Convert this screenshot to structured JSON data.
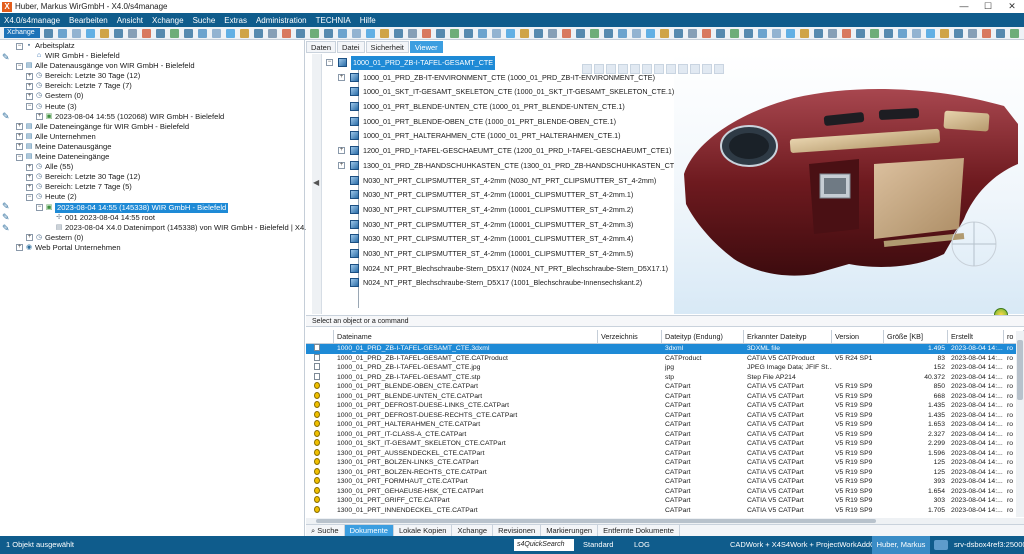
{
  "window": {
    "title": "Huber, Markus WirGmbH - X4.0/s4manage",
    "app_icon": "X",
    "minimize": "—",
    "maximize": "☐",
    "close": "✕"
  },
  "menu": [
    "X4.0/s4manage",
    "Bearbeiten",
    "Ansicht",
    "Xchange",
    "Suche",
    "Extras",
    "Administration",
    "TECHNIA",
    "Hilfe"
  ],
  "toolbar": {
    "select_value": "Xchange",
    "icon_count": 70
  },
  "tree": [
    {
      "label": "Arbeitsplatz",
      "level": 0,
      "exp": "-",
      "icon": "▪",
      "color": "#5a7a9a"
    },
    {
      "label": "WIR GmbH - Bielefeld",
      "level": 1,
      "exp": "",
      "icon": "⌂",
      "color": "#1e5fa8"
    },
    {
      "label": "Alle Datenausgänge von WIR GmbH - Bielefeld",
      "level": 0,
      "exp": "-",
      "icon": "▤",
      "color": "#2f6f9e"
    },
    {
      "label": "Bereich: Letzte 30 Tage (12)",
      "level": 1,
      "exp": "+",
      "icon": "◷",
      "color": "#4a6a8a"
    },
    {
      "label": "Bereich: Letzte 7 Tage (7)",
      "level": 1,
      "exp": "+",
      "icon": "◷",
      "color": "#4a6a8a"
    },
    {
      "label": "Gestern (0)",
      "level": 1,
      "exp": "+",
      "icon": "◷",
      "color": "#4a6a8a"
    },
    {
      "label": "Heute (3)",
      "level": 1,
      "exp": "-",
      "icon": "◷",
      "color": "#4a6a8a"
    },
    {
      "label": "2023-08-04 14:55 (102068) WIR GmbH - Bielefeld",
      "level": 2,
      "exp": "+",
      "icon": "▣",
      "color": "#3f8f3f"
    },
    {
      "label": "Alle Dateneingänge für WIR GmbH - Bielefeld",
      "level": 0,
      "exp": "+",
      "icon": "▤",
      "color": "#2f6f9e"
    },
    {
      "label": "Alle Unternehmen",
      "level": 0,
      "exp": "+",
      "icon": "▤",
      "color": "#2f6f9e"
    },
    {
      "label": "Meine Datenausgänge",
      "level": 0,
      "exp": "+",
      "icon": "▤",
      "color": "#2f6f9e"
    },
    {
      "label": "Meine Dateneingänge",
      "level": 0,
      "exp": "-",
      "icon": "▤",
      "color": "#2f6f9e"
    },
    {
      "label": "Alle (55)",
      "level": 1,
      "exp": "+",
      "icon": "◷",
      "color": "#4a6a8a"
    },
    {
      "label": "Bereich: Letzte 30 Tage (12)",
      "level": 1,
      "exp": "+",
      "icon": "◷",
      "color": "#4a6a8a"
    },
    {
      "label": "Bereich: Letzte 7 Tage (5)",
      "level": 1,
      "exp": "+",
      "icon": "◷",
      "color": "#4a6a8a"
    },
    {
      "label": "Heute (2)",
      "level": 1,
      "exp": "-",
      "icon": "◷",
      "color": "#4a6a8a"
    },
    {
      "label": "2023-08-04 14:55 (145338) WIR GmbH - Bielefeld",
      "level": 2,
      "exp": "-",
      "icon": "▣",
      "color": "#3f8f3f",
      "selected": true
    },
    {
      "label": "001 2023-08-04 14:55 root",
      "level": 3,
      "exp": "",
      "icon": "✢",
      "color": "#7a8a9a"
    },
    {
      "label": "2023-08-04 X4.0 Datenimport (145338) von WIR GmbH - Bielefeld | X4...",
      "level": 3,
      "exp": "",
      "icon": "▤",
      "color": "#7a8a9a"
    },
    {
      "label": "Gestern (0)",
      "level": 1,
      "exp": "+",
      "icon": "◷",
      "color": "#4a6a8a"
    },
    {
      "label": "Web Portal Unternehmen",
      "level": 0,
      "exp": "+",
      "icon": "◉",
      "color": "#2f6f9e"
    }
  ],
  "tabs": [
    {
      "label": "Daten"
    },
    {
      "label": "Datei"
    },
    {
      "label": "Sicherheit"
    },
    {
      "label": "Viewer",
      "active": true
    }
  ],
  "ptree": [
    "1000_01_PRD_ZB-I-TAFEL-GESAMT_CTE",
    "1000_01_PRD_ZB-IT-ENVIRONMENT_CTE (1000_01_PRD_ZB-IT-ENVIRONMENT_CTE)",
    "1000_01_SKT_IT-GESAMT_SKELETON_CTE (1000_01_SKT_IT-GESAMT_SKELETON_CTE.1)",
    "1000_01_PRT_BLENDE-UNTEN_CTE (1000_01_PRT_BLENDE-UNTEN_CTE.1)",
    "1000_01_PRT_BLENDE-OBEN_CTE (1000_01_PRT_BLENDE-OBEN_CTE.1)",
    "1000_01_PRT_HALTERAHMEN_CTE (1000_01_PRT_HALTERAHMEN_CTE.1)",
    "1200_01_PRD_I-TAFEL-GESCHAEUMT_CTE (1200_01_PRD_I-TAFEL-GESCHAEUMT_CTE1)",
    "1300_01_PRD_ZB-HANDSCHUHKASTEN_CTE (1300_01_PRD_ZB-HANDSCHUHKASTEN_CTI",
    "N030_NT_PRT_CLIPSMUTTER_ST_4-2mm (N030_NT_PRT_CLIPSMUTTER_ST_4-2mm)",
    "N030_NT_PRT_CLIPSMUTTER_ST_4-2mm (10001_CLIPSMUTTER_ST_4-2mm.1)",
    "N030_NT_PRT_CLIPSMUTTER_ST_4-2mm (10001_CLIPSMUTTER_ST_4-2mm.2)",
    "N030_NT_PRT_CLIPSMUTTER_ST_4-2mm (10001_CLIPSMUTTER_ST_4-2mm.3)",
    "N030_NT_PRT_CLIPSMUTTER_ST_4-2mm (10001_CLIPSMUTTER_ST_4-2mm.4)",
    "N030_NT_PRT_CLIPSMUTTER_ST_4-2mm (10001_CLIPSMUTTER_ST_4-2mm.5)",
    "N024_NT_PRT_Blechschraube-Stern_D5X17 (N024_NT_PRT_Blechschraube-Stern_D5X17.1)",
    "N024_NT_PRT_Blechschraube-Stern_D5X17 (1001_Blechschraube-Innensechskant.2)"
  ],
  "cmdbar": "Select an object or a command",
  "table": {
    "columns": [
      {
        "label": "",
        "w": 28
      },
      {
        "label": "Dateiname",
        "w": 264
      },
      {
        "label": "Verzeichnis",
        "w": 64
      },
      {
        "label": "Dateityp (Endung)",
        "w": 82
      },
      {
        "label": "Erkannter Dateityp",
        "w": 88
      },
      {
        "label": "Version",
        "w": 52
      },
      {
        "label": "Größe [KB]",
        "w": 64
      },
      {
        "label": "Erstellt",
        "w": 56
      },
      {
        "label": "ro",
        "w": 20
      }
    ],
    "rows": [
      {
        "icon": "file",
        "name": "1000_01_PRD_ZB-I-TAFEL-GESAMT_CTE.3dxml",
        "ext": "3dxml",
        "type": "3DXML file",
        "ver": "",
        "size": "1.495",
        "date": "2023-08-04 14:...",
        "ro": "ro",
        "sel": true
      },
      {
        "icon": "file",
        "name": "1000_01_PRD_ZB-I-TAFEL-GESAMT_CTE.CATProduct",
        "ext": "CATProduct",
        "type": "CATIA V5 CATProduct",
        "ver": "V5 R24 SP1",
        "size": "83",
        "date": "2023-08-04 14:...",
        "ro": "ro"
      },
      {
        "icon": "file",
        "name": "1000_01_PRD_ZB-I-TAFEL-GESAMT_CTE.jpg",
        "ext": "jpg",
        "type": "JPEG Image Data; JFIF St...",
        "ver": "",
        "size": "152",
        "date": "2023-08-04 14:...",
        "ro": "ro"
      },
      {
        "icon": "file",
        "name": "1000_01_PRD_ZB-I-TAFEL-GESAMT_CTE.stp",
        "ext": "stp",
        "type": "Step File AP214",
        "ver": "",
        "size": "40.372",
        "date": "2023-08-04 14:...",
        "ro": "ro"
      },
      {
        "icon": "cad",
        "name": "1000_01_PRT_BLENDE-OBEN_CTE.CATPart",
        "ext": "CATPart",
        "type": "CATIA V5 CATPart",
        "ver": "V5 R19 SP9",
        "size": "850",
        "date": "2023-08-04 14:...",
        "ro": "ro"
      },
      {
        "icon": "cad",
        "name": "1000_01_PRT_BLENDE-UNTEN_CTE.CATPart",
        "ext": "CATPart",
        "type": "CATIA V5 CATPart",
        "ver": "V5 R19 SP9",
        "size": "668",
        "date": "2023-08-04 14:...",
        "ro": "ro"
      },
      {
        "icon": "cad",
        "name": "1000_01_PRT_DEFROST-DUESE-LINKS_CTE.CATPart",
        "ext": "CATPart",
        "type": "CATIA V5 CATPart",
        "ver": "V5 R19 SP9",
        "size": "1.435",
        "date": "2023-08-04 14:...",
        "ro": "ro"
      },
      {
        "icon": "cad",
        "name": "1000_01_PRT_DEFROST-DUESE-RECHTS_CTE.CATPart",
        "ext": "CATPart",
        "type": "CATIA V5 CATPart",
        "ver": "V5 R19 SP9",
        "size": "1.435",
        "date": "2023-08-04 14:...",
        "ro": "ro"
      },
      {
        "icon": "cad",
        "name": "1000_01_PRT_HALTERAHMEN_CTE.CATPart",
        "ext": "CATPart",
        "type": "CATIA V5 CATPart",
        "ver": "V5 R19 SP9",
        "size": "1.653",
        "date": "2023-08-04 14:...",
        "ro": "ro"
      },
      {
        "icon": "cad",
        "name": "1000_01_PRT_IT-CLASS-A_CTE.CATPart",
        "ext": "CATPart",
        "type": "CATIA V5 CATPart",
        "ver": "V5 R19 SP9",
        "size": "2.327",
        "date": "2023-08-04 14:...",
        "ro": "ro"
      },
      {
        "icon": "cad",
        "name": "1000_01_SKT_IT-GESAMT_SKELETON_CTE.CATPart",
        "ext": "CATPart",
        "type": "CATIA V5 CATPart",
        "ver": "V5 R19 SP9",
        "size": "2.299",
        "date": "2023-08-04 14:...",
        "ro": "ro"
      },
      {
        "icon": "cad",
        "name": "1300_01_PRT_AUSSENDECKEL_CTE.CATPart",
        "ext": "CATPart",
        "type": "CATIA V5 CATPart",
        "ver": "V5 R19 SP9",
        "size": "1.596",
        "date": "2023-08-04 14:...",
        "ro": "ro"
      },
      {
        "icon": "cad",
        "name": "1300_01_PRT_BOLZEN-LINKS_CTE.CATPart",
        "ext": "CATPart",
        "type": "CATIA V5 CATPart",
        "ver": "V5 R19 SP9",
        "size": "125",
        "date": "2023-08-04 14:...",
        "ro": "ro"
      },
      {
        "icon": "cad",
        "name": "1300_01_PRT_BOLZEN-RECHTS_CTE.CATPart",
        "ext": "CATPart",
        "type": "CATIA V5 CATPart",
        "ver": "V5 R19 SP9",
        "size": "125",
        "date": "2023-08-04 14:...",
        "ro": "ro"
      },
      {
        "icon": "cad",
        "name": "1300_01_PRT_FORMHAUT_CTE.CATPart",
        "ext": "CATPart",
        "type": "CATIA V5 CATPart",
        "ver": "V5 R19 SP9",
        "size": "393",
        "date": "2023-08-04 14:...",
        "ro": "ro"
      },
      {
        "icon": "cad",
        "name": "1300_01_PRT_GEHAEUSE-HSK_CTE.CATPart",
        "ext": "CATPart",
        "type": "CATIA V5 CATPart",
        "ver": "V5 R19 SP9",
        "size": "1.654",
        "date": "2023-08-04 14:...",
        "ro": "ro"
      },
      {
        "icon": "cad",
        "name": "1300_01_PRT_GRIFF_CTE.CATPart",
        "ext": "CATPart",
        "type": "CATIA V5 CATPart",
        "ver": "V5 R19 SP9",
        "size": "303",
        "date": "2023-08-04 14:...",
        "ro": "ro"
      },
      {
        "icon": "cad",
        "name": "1300_01_PRT_INNENDECKEL_CTE.CATPart",
        "ext": "CATPart",
        "type": "CATIA V5 CATPart",
        "ver": "V5 R19 SP9",
        "size": "1.705",
        "date": "2023-08-04 14:...",
        "ro": "ro"
      }
    ]
  },
  "bottom_tabs": [
    {
      "label": "Suche"
    },
    {
      "label": "Dokumente",
      "active": true
    },
    {
      "label": "Lokale Kopien"
    },
    {
      "label": "Xchange"
    },
    {
      "label": "Revisionen"
    },
    {
      "label": "Markierungen"
    },
    {
      "label": "Entfernte Dokumente"
    }
  ],
  "status": {
    "selection": "1 Objekt ausgewählt",
    "quick": "s4QuickSearch",
    "mode": "Standard",
    "log": "LOG",
    "addons": "CADWork + X4S4Work + ProjectWorkAddOn",
    "user": "Huber, Markus",
    "server": "srv-dsbox4ref3:25000"
  },
  "colors": {
    "menubar": "#0f5c8c",
    "accent": "#1e8ad6",
    "model": "#6e1a1f"
  }
}
